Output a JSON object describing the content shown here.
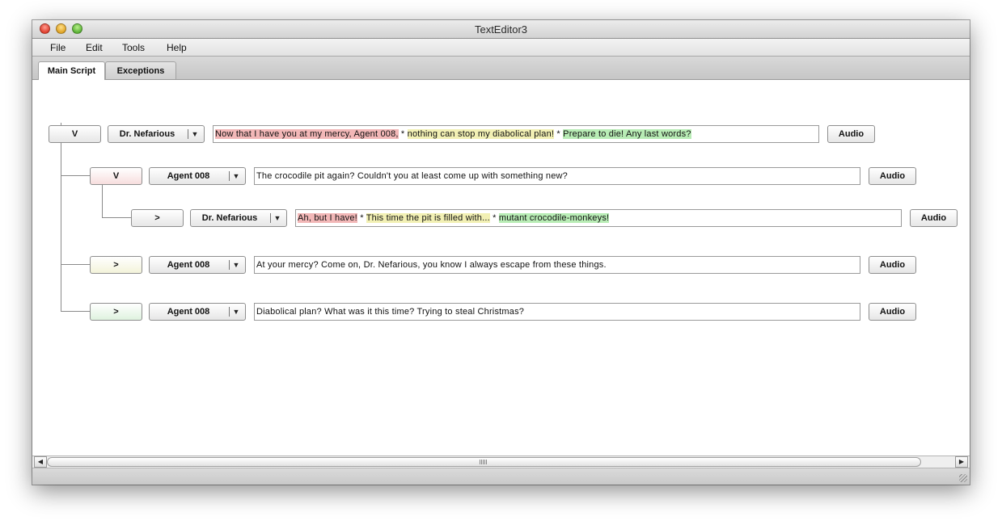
{
  "window": {
    "title": "TextEditor3"
  },
  "menu": [
    "File",
    "Edit",
    "Tools",
    "Help"
  ],
  "tabs": [
    {
      "label": "Main Script",
      "active": true
    },
    {
      "label": "Exceptions",
      "active": false
    }
  ],
  "rows": [
    {
      "toggle": "V",
      "toggle_color": "white",
      "speaker": "Dr. Nefarious",
      "segments": [
        {
          "text": "Now that I have you at my mercy, Agent 008,",
          "color": "pink"
        },
        {
          "text": " * ",
          "color": "none"
        },
        {
          "text": "nothing can stop my diabolical plan!",
          "color": "yellow"
        },
        {
          "text": " * ",
          "color": "none"
        },
        {
          "text": "Prepare to die! Any last words?",
          "color": "green"
        }
      ],
      "audio": "Audio"
    },
    {
      "toggle": "V",
      "toggle_color": "pink",
      "speaker": "Agent 008",
      "segments": [
        {
          "text": "The crocodile pit again? Couldn't you at least come up with something new?",
          "color": "none"
        }
      ],
      "audio": "Audio"
    },
    {
      "toggle": ">",
      "toggle_color": "white",
      "speaker": "Dr. Nefarious",
      "segments": [
        {
          "text": "Ah, but I have!",
          "color": "pink"
        },
        {
          "text": " * ",
          "color": "none"
        },
        {
          "text": "This time the pit is filled with...",
          "color": "yellow"
        },
        {
          "text": " * ",
          "color": "none"
        },
        {
          "text": "mutant crocodile-monkeys!",
          "color": "green"
        }
      ],
      "audio": "Audio"
    },
    {
      "toggle": ">",
      "toggle_color": "yellow",
      "speaker": "Agent 008",
      "segments": [
        {
          "text": "At your mercy? Come on, Dr. Nefarious, you know I always escape from these things.",
          "color": "none"
        }
      ],
      "audio": "Audio"
    },
    {
      "toggle": ">",
      "toggle_color": "green",
      "speaker": "Agent 008",
      "segments": [
        {
          "text": "Diabolical plan? What was it this time? Trying to steal Christmas?",
          "color": "none"
        }
      ],
      "audio": "Audio"
    }
  ],
  "dropdown_arrow": "▼",
  "scroll": {
    "left_arrow": "◀",
    "right_arrow": "▶"
  }
}
